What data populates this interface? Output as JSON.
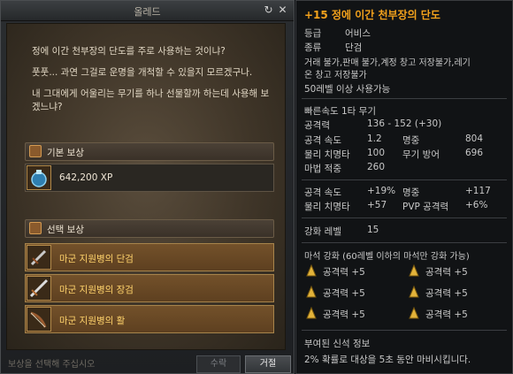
{
  "quest": {
    "window_title": "올레드",
    "dialog_line1": "정에 이간 천부장의 단도를 주로 사용하는 것이냐?",
    "dialog_line2": "풋풋... 과연 그걸로 운명을 개척할 수 있을지 모르겠구나.",
    "dialog_line3a": "내 그대에게 어울리는 무기를 하나 선물할까 하는데 사용해 보",
    "dialog_line3b": "겠느냐?",
    "base_reward_title": "기본 보상",
    "base_reward_xp": "642,200 XP",
    "choice_reward_title": "선택 보상",
    "choice_items": [
      "마군 지원병의 단검",
      "마군 지원병의 장검",
      "마군 지원병의 활"
    ],
    "footer_text": "보상을 선택해 주십시오",
    "accept_label": "수락",
    "decline_label": "거절"
  },
  "tooltip": {
    "title": "+15 정에 이간 천부장의 단도",
    "grade_label": "등급",
    "grade_value": "어비스",
    "type_label": "종류",
    "type_value": "단검",
    "restriction_line1": "거래 불가,판매 불가,계정 창고 저장불가,레기",
    "restriction_line2": "온 창고 저장불가",
    "level_req": "50레벨 이상 사용가능",
    "attack_speed_title": "빠른속도 1타 무기",
    "stats": {
      "atk_label": "공격력",
      "atk_value": "136 - 152 (+30)",
      "aspd_label": "공격 속도",
      "aspd_value": "1.2",
      "acc_label": "명중",
      "acc_value": "804",
      "crit_label": "물리 치명타",
      "crit_value": "100",
      "block_label": "무기 방어",
      "block_value": "696",
      "macc_label": "마법 적중",
      "macc_value": "260"
    },
    "bonus": {
      "aspd_label": "공격 속도",
      "aspd_value": "+19%",
      "acc_label": "명중",
      "acc_value": "+117",
      "crit_label": "물리 치명타",
      "crit_value": "+57",
      "pvp_label": "PVP 공격력",
      "pvp_value": "+6%"
    },
    "enchant_label": "강화 레벨",
    "enchant_value": "15",
    "manastone_header": "마석 강화 (60레벨 이하의 마석만 강화 가능)",
    "manastones": [
      "공격력 +5",
      "공격력 +5",
      "공격력 +5",
      "공격력 +5",
      "공격력 +5",
      "공격력 +5"
    ],
    "godstone_title": "부여된 신석 정보",
    "godstone_desc": "2% 확률로 대상을 5초 동안 마비시킵니다."
  },
  "colors": {
    "title_orange": "#f3a21c",
    "gold_text": "#ffd36b"
  },
  "icons": [
    "refresh-icon",
    "close-icon",
    "chest-icon",
    "potion-icon",
    "dagger-icon",
    "sword-icon",
    "bow-icon",
    "manastone-icon"
  ]
}
